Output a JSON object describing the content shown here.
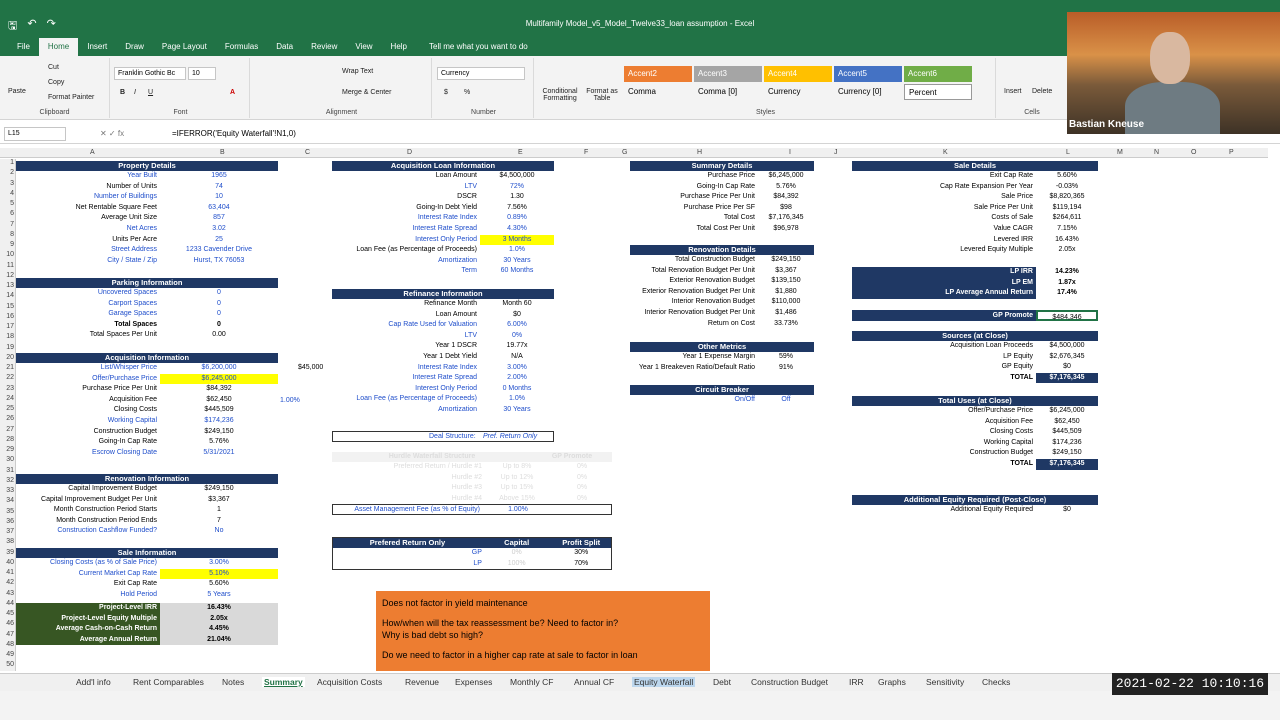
{
  "window": {
    "title": "Multifamily Model_v5_Model_Twelve33_loan assumption - Excel"
  },
  "menu": [
    "File",
    "Home",
    "Insert",
    "Draw",
    "Page Layout",
    "Formulas",
    "Data",
    "Review",
    "View",
    "Help"
  ],
  "tell_me": "Tell me what you want to do",
  "ribbon": {
    "paste": "Paste",
    "cut": "Cut",
    "copy": "Copy",
    "format_painter": "Format Painter",
    "clipboard": "Clipboard",
    "font_name": "Franklin Gothic Bc",
    "font_size": "10",
    "font": "Font",
    "wrap_text": "Wrap Text",
    "merge_center": "Merge & Center",
    "alignment": "Alignment",
    "number_format": "Currency",
    "number": "Number",
    "cond_format": "Conditional Formatting",
    "format_table": "Format as Table",
    "styles": "Styles",
    "insert": "Insert",
    "delete": "Delete",
    "cells": "Cells",
    "style_cells": [
      "Accent2",
      "Accent3",
      "Accent4",
      "Accent5",
      "Accent6",
      "Comma",
      "Comma [0]",
      "Currency",
      "Currency [0]",
      "Percent"
    ]
  },
  "formula_bar": {
    "name_box": "L15",
    "formula": "=IFERROR('Equity Waterfall'!N1,0)"
  },
  "columns": [
    "A",
    "B",
    "C",
    "D",
    "E",
    "F",
    "G",
    "H",
    "I",
    "J",
    "K",
    "L",
    "M",
    "N",
    "O",
    "P"
  ],
  "property": {
    "title": "Property Details",
    "rows": [
      [
        "Year Built",
        "1965"
      ],
      [
        "Number of Units",
        "74"
      ],
      [
        "Number of Buildings",
        "10"
      ],
      [
        "Net Rentable Square Feet",
        "63,404"
      ],
      [
        "Average Unit Size",
        "857"
      ],
      [
        "Net Acres",
        "3.02"
      ],
      [
        "Units Per Acre",
        "25"
      ],
      [
        "Street Address",
        "1233 Cavender Drive"
      ],
      [
        "City / State / Zip",
        "Hurst, TX 76053"
      ]
    ]
  },
  "parking": {
    "title": "Parking Information",
    "rows": [
      [
        "Uncovered Spaces",
        "0"
      ],
      [
        "Carport Spaces",
        "0"
      ],
      [
        "Garage Spaces",
        "0"
      ],
      [
        "Total Spaces",
        "0"
      ],
      [
        "Total Spaces Per Unit",
        "0.00"
      ]
    ]
  },
  "acquisition": {
    "title": "Acquisition Information",
    "rows": [
      [
        "List/Whisper Price",
        "$6,200,000"
      ],
      [
        "Offer/Purchase Price",
        "$6,245,000"
      ],
      [
        "Purchase Price Per Unit",
        "$84,392"
      ],
      [
        "Acquisition Fee",
        "$62,450"
      ],
      [
        "Closing Costs",
        "$445,509"
      ],
      [
        "Working Capital",
        "$174,236"
      ],
      [
        "Construction Budget",
        "$249,150"
      ],
      [
        "Going-In Cap Rate",
        "5.76%"
      ],
      [
        "Escrow Closing Date",
        "5/31/2021"
      ]
    ],
    "c_note1": "$45,000",
    "c_note2": "1.00%"
  },
  "renovation": {
    "title": "Renovation Information",
    "rows": [
      [
        "Capital Improvement Budget",
        "$249,150"
      ],
      [
        "Capital Improvement Budget Per Unit",
        "$3,367"
      ],
      [
        "Month Construction Period Starts",
        "1"
      ],
      [
        "Month Construction Period Ends",
        "7"
      ],
      [
        "Construction Cashflow Funded?",
        "No"
      ]
    ]
  },
  "sale": {
    "title": "Sale Information",
    "rows": [
      [
        "Closing Costs (as % of Sale Price)",
        "3.00%"
      ],
      [
        "Current Market Cap Rate",
        "5.10%"
      ],
      [
        "Exit Cap Rate",
        "5.60%"
      ],
      [
        "Hold Period",
        "5 Years"
      ]
    ],
    "summary": [
      [
        "Project-Level IRR",
        "16.43%"
      ],
      [
        "Project-Level Equity Multiple",
        "2.05x"
      ],
      [
        "Average Cash-on-Cash Return",
        "4.45%"
      ],
      [
        "Average Annual Return",
        "21.04%"
      ]
    ]
  },
  "acq_loan": {
    "title": "Acquisition Loan Information",
    "rows": [
      [
        "Loan Amount",
        "$4,500,000"
      ],
      [
        "LTV",
        "72%"
      ],
      [
        "DSCR",
        "1.30"
      ],
      [
        "Going-In Debt Yield",
        "7.56%"
      ],
      [
        "Interest Rate Index",
        "0.89%"
      ],
      [
        "Interest Rate Spread",
        "4.30%"
      ],
      [
        "Interest Only Period",
        "3 Months"
      ],
      [
        "Loan Fee (as Percentage of Proceeds)",
        "1.0%"
      ],
      [
        "Amortization",
        "30 Years"
      ],
      [
        "Term",
        "60 Months"
      ]
    ]
  },
  "refinance": {
    "title": "Refinance Information",
    "rows": [
      [
        "Refinance Month",
        "Month 60"
      ],
      [
        "Loan Amount",
        "$0"
      ],
      [
        "Cap Rate Used for Valuation",
        "6.00%"
      ],
      [
        "LTV",
        "0%"
      ],
      [
        "Year 1 DSCR",
        "19.77x"
      ],
      [
        "Year 1 Debt Yield",
        "N/A"
      ],
      [
        "Interest Rate Index",
        "3.00%"
      ],
      [
        "Interest Rate Spread",
        "2.00%"
      ],
      [
        "Interest Only Period",
        "0 Months"
      ],
      [
        "Loan Fee (as Percentage of Proceeds)",
        "1.0%"
      ],
      [
        "Amortization",
        "30 Years"
      ]
    ]
  },
  "deal": {
    "label": "Deal Structure:",
    "value": "Pref. Return Only"
  },
  "hurdle": {
    "title": "Hurdle Waterfall Structure",
    "gp": "GP Promote",
    "rows": [
      [
        "Preferred Return / Hurdle #1",
        "Up to 8%",
        "0%"
      ],
      [
        "Hurdle #2",
        "Up to 12%",
        "0%"
      ],
      [
        "Hurdle #3",
        "Up to 15%",
        "0%"
      ],
      [
        "Hurdle #4",
        "Above 15%",
        "0%"
      ]
    ],
    "amf_label": "Asset Management Fee (as % of Equity)",
    "amf": "1.00%"
  },
  "pref": {
    "title": "Prefered Return Only",
    "cap": "Capital",
    "split": "Profit Split",
    "rows": [
      [
        "GP",
        "0%",
        "30%"
      ],
      [
        "LP",
        "100%",
        "70%"
      ]
    ]
  },
  "summary": {
    "title": "Summary Details",
    "rows": [
      [
        "Purchase Price",
        "$6,245,000"
      ],
      [
        "Going-In Cap Rate",
        "5.76%"
      ],
      [
        "Purchase Price Per Unit",
        "$84,392"
      ],
      [
        "Purchase Price Per SF",
        "$98"
      ],
      [
        "Total Cost",
        "$7,176,345"
      ],
      [
        "Total Cost Per Unit",
        "$96,978"
      ]
    ]
  },
  "reno_details": {
    "title": "Renovation Details",
    "rows": [
      [
        "Total Construction Budget",
        "$249,150"
      ],
      [
        "Total Renovation Budget Per Unit",
        "$3,367"
      ],
      [
        "Exterior Renovation Budget",
        "$139,150"
      ],
      [
        "Exterior Renovation Budget Per Unit",
        "$1,880"
      ],
      [
        "Interior Renovation Budget",
        "$110,000"
      ],
      [
        "Interior Renovation Budget Per Unit",
        "$1,486"
      ],
      [
        "Return on Cost",
        "33.73%"
      ]
    ]
  },
  "other": {
    "title": "Other Metrics",
    "rows": [
      [
        "Year 1 Expense Margin",
        "59%"
      ],
      [
        "Year 1 Breakeven Ratio/Default Ratio",
        "91%"
      ]
    ]
  },
  "circuit": {
    "title": "Circuit Breaker",
    "rows": [
      [
        "On/Off",
        "Off"
      ]
    ]
  },
  "sale_details": {
    "title": "Sale Details",
    "rows": [
      [
        "Exit Cap Rate",
        "5.60%"
      ],
      [
        "Cap Rate Expansion Per Year",
        "-0.03%"
      ],
      [
        "Sale Price",
        "$8,820,365"
      ],
      [
        "Sale Price Per Unit",
        "$119,194"
      ],
      [
        "Costs of Sale",
        "$264,611"
      ],
      [
        "Value CAGR",
        "7.15%"
      ],
      [
        "Levered IRR",
        "16.43%"
      ],
      [
        "Levered Equity Multiple",
        "2.05x"
      ]
    ]
  },
  "lp": {
    "rows": [
      [
        "LP IRR",
        "14.23%"
      ],
      [
        "LP EM",
        "1.87x"
      ],
      [
        "LP Average Annual Return",
        "17.4%"
      ]
    ]
  },
  "gp_promote": {
    "label": "GP Promote",
    "value": "$484,346"
  },
  "sources": {
    "title": "Sources (at Close)",
    "rows": [
      [
        "Acquisition Loan Proceeds",
        "$4,500,000"
      ],
      [
        "LP Equity",
        "$2,676,345"
      ],
      [
        "GP Equity",
        "$0"
      ]
    ],
    "total": [
      "TOTAL",
      "$7,176,345"
    ]
  },
  "uses": {
    "title": "Total Uses (at Close)",
    "rows": [
      [
        "Offer/Purchase Price",
        "$6,245,000"
      ],
      [
        "Acquisition Fee",
        "$62,450"
      ],
      [
        "Closing Costs",
        "$445,509"
      ],
      [
        "Working Capital",
        "$174,236"
      ],
      [
        "Construction Budget",
        "$249,150"
      ]
    ],
    "total": [
      "TOTAL",
      "$7,176,345"
    ]
  },
  "additional": {
    "title": "Additional Equity Required (Post-Close)",
    "rows": [
      [
        "Additional Equity Required",
        "$0"
      ]
    ]
  },
  "note": [
    "Does not factor in yield maintenance",
    "How/when will the tax reassessment be? Need to factor in?",
    "Why is bad debt so high?",
    "Do we need to factor in a higher cap rate at sale to factor in loan"
  ],
  "sheets": [
    "Add'l info",
    "Rent Comparables",
    "Notes",
    "Summary",
    "Acquisition Costs",
    "Revenue",
    "Expenses",
    "Monthly CF",
    "Annual CF",
    "Equity Waterfall",
    "Debt",
    "Construction Budget",
    "IRR",
    "Graphs",
    "Sensitivity",
    "Checks"
  ],
  "webcam": {
    "name": "Bastian Kneuse"
  },
  "clock": "2021-02-22 10:10:16"
}
